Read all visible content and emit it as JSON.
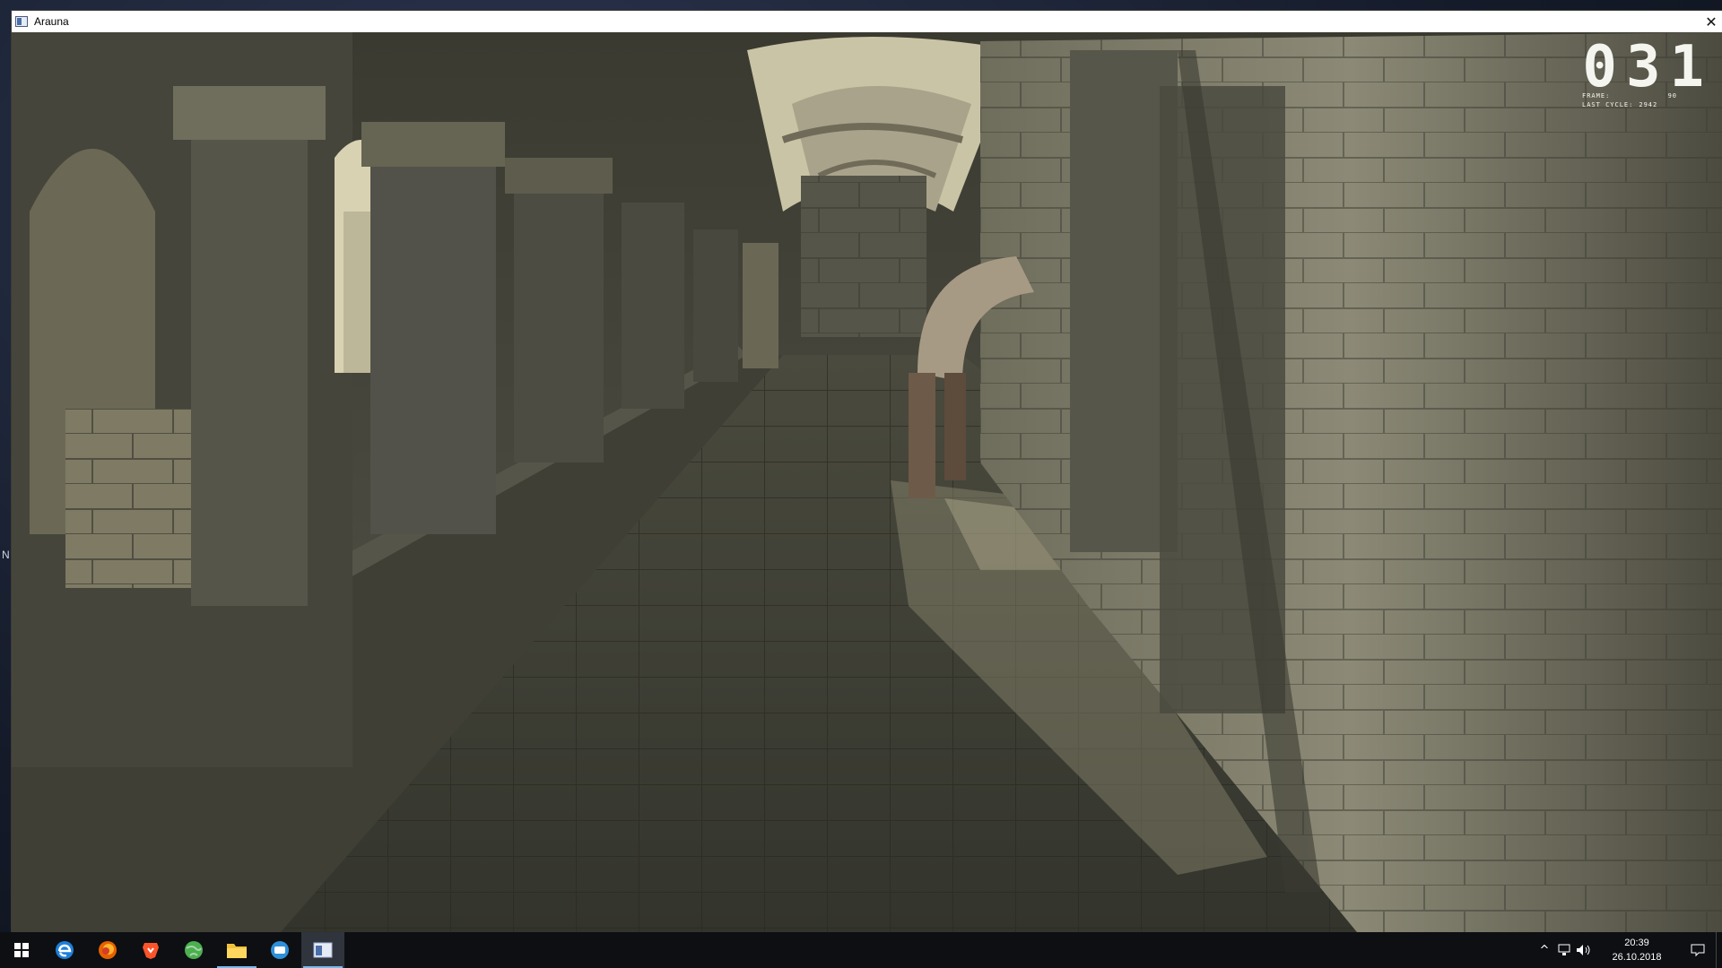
{
  "window": {
    "title": "Arauna",
    "close_glyph": "✕"
  },
  "hud": {
    "counter": "031",
    "frame_label": "FRAME:",
    "frame_value": "90",
    "cycle_label": "LAST CYCLE:",
    "cycle_value": "2942"
  },
  "desktop": {
    "edge_glyph": "N"
  },
  "taskbar": {
    "apps": [
      {
        "name": "start-button",
        "icon": "windows-logo-icon"
      },
      {
        "name": "edge",
        "icon": "edge-icon"
      },
      {
        "name": "firefox",
        "icon": "firefox-icon"
      },
      {
        "name": "brave",
        "icon": "brave-icon"
      },
      {
        "name": "globe-app",
        "icon": "globe-icon"
      },
      {
        "name": "file-explorer",
        "icon": "folder-icon"
      },
      {
        "name": "chat-app",
        "icon": "chat-icon"
      },
      {
        "name": "arauna",
        "icon": "window-app-icon"
      }
    ],
    "tray_chevron": "^",
    "time": "20:39",
    "date": "26.10.2018"
  },
  "colors": {
    "taskbar_bg": "#0d0f13",
    "active_underline": "#76b9ed",
    "stone_light": "#cfc9ad",
    "stone_shadow": "#2d2e27"
  }
}
